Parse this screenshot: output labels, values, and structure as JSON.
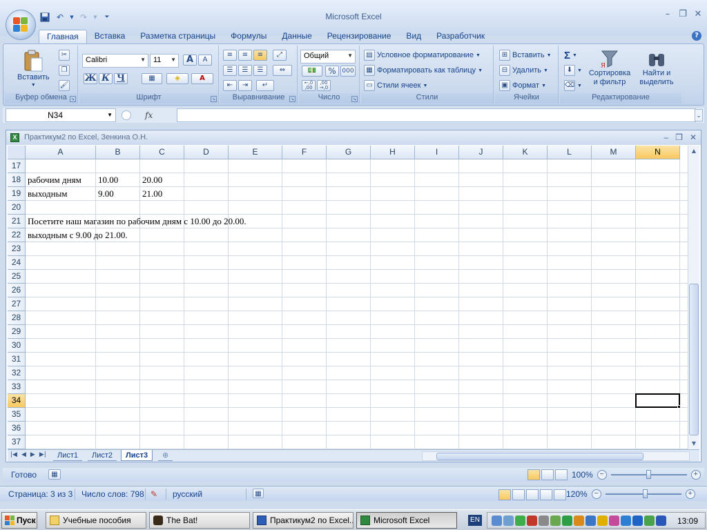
{
  "window": {
    "title": "Microsoft Excel"
  },
  "ribbon_tabs": [
    "Главная",
    "Вставка",
    "Разметка страницы",
    "Формулы",
    "Данные",
    "Рецензирование",
    "Вид",
    "Разработчик"
  ],
  "active_tab": "Главная",
  "ribbon": {
    "clipboard": {
      "label": "Буфер обмена",
      "paste": "Вставить"
    },
    "font": {
      "label": "Шрифт",
      "font_name": "Calibri",
      "font_size": "11",
      "bold": "Ж",
      "italic": "К",
      "underline": "Ч",
      "grow": "A",
      "shrink": "A"
    },
    "alignment": {
      "label": "Выравнивание"
    },
    "number": {
      "label": "Число",
      "format": "Общий",
      "percent": "%",
      "thousands": "000",
      "inc_decimal": "←,0 ,00",
      "dec_decimal": ",00 →,0"
    },
    "styles": {
      "label": "Стили",
      "conditional": "Условное форматирование",
      "format_table": "Форматировать как таблицу",
      "cell_styles": "Стили ячеек"
    },
    "cells": {
      "label": "Ячейки",
      "insert": "Вставить",
      "delete": "Удалить",
      "format": "Формат"
    },
    "editing": {
      "label": "Редактирование",
      "sigma": "Σ",
      "sort": "Сортировка и фильтр",
      "find": "Найти и выделить"
    }
  },
  "formula_bar": {
    "name_box": "N34",
    "fx": "fx",
    "formula": ""
  },
  "workbook": {
    "title": "Практикум2 по Excel, Зенкина О.Н."
  },
  "columns": [
    "A",
    "B",
    "C",
    "D",
    "E",
    "F",
    "G",
    "H",
    "I",
    "J",
    "K",
    "L",
    "M",
    "N"
  ],
  "rows": [
    "17",
    "18",
    "19",
    "20",
    "21",
    "22",
    "23",
    "24",
    "25",
    "26",
    "27",
    "28",
    "29",
    "30",
    "31",
    "32",
    "33",
    "34",
    "35",
    "36",
    "37"
  ],
  "selected_cell": {
    "column": "N",
    "row": "34"
  },
  "cells": {
    "A18": "рабочим дням",
    "B18": "10.00",
    "C18": "20.00",
    "A19": "выходным",
    "B19": "9.00",
    "C19": "21.00",
    "A21": "Посетите наш магазин по рабочим дням с 10.00 до 20.00.",
    "A22": "выходным с 9.00  до 21.00."
  },
  "sheet_tabs": [
    "Лист1",
    "Лист2",
    "Лист3"
  ],
  "active_sheet": "Лист3",
  "excel_status": {
    "ready": "Готово",
    "zoom": "100%",
    "zoom_level": 100
  },
  "word_status": {
    "page": "Страница: 3 из 3",
    "words": "Число слов: 798",
    "language": "русский",
    "zoom": "120%",
    "zoom_level": 120
  },
  "taskbar": {
    "start": "Пуск",
    "tasks": [
      "Учебные пособия",
      "The Bat!",
      "Практикум2 по Excel....",
      "Microsoft Excel"
    ],
    "active_task": "Microsoft Excel",
    "lang": "EN",
    "clock": "13:09"
  }
}
